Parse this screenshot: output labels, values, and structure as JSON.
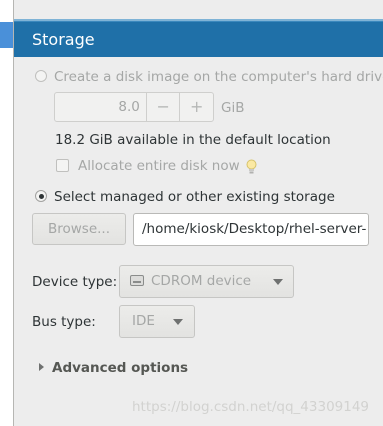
{
  "header": {
    "title": "Storage"
  },
  "create_disk": {
    "radio_label": "Create a disk image on the computer's hard drive",
    "size_value": "8.0",
    "unit": "GiB",
    "minus_label": "−",
    "plus_label": "+",
    "available_text": "18.2 GiB available in the default location",
    "allocate_label": "Allocate entire disk now"
  },
  "existing_storage": {
    "radio_label": "Select managed or other existing storage",
    "browse_label": "Browse...",
    "path_value": "/home/kiosk/Desktop/rhel-server-"
  },
  "device": {
    "label": "Device type:",
    "value": "CDROM device",
    "icon": "cdrom-icon"
  },
  "bus": {
    "label": "Bus type:",
    "value": "IDE"
  },
  "advanced": {
    "label": "Advanced options"
  },
  "watermark": {
    "text": "https://blog.csdn.net/qq_43309149"
  },
  "colors": {
    "header_bg": "#1f70a8",
    "panel_bg": "#ededed",
    "selection": "#4a90d9",
    "disabled_text": "#a5a7a6"
  }
}
